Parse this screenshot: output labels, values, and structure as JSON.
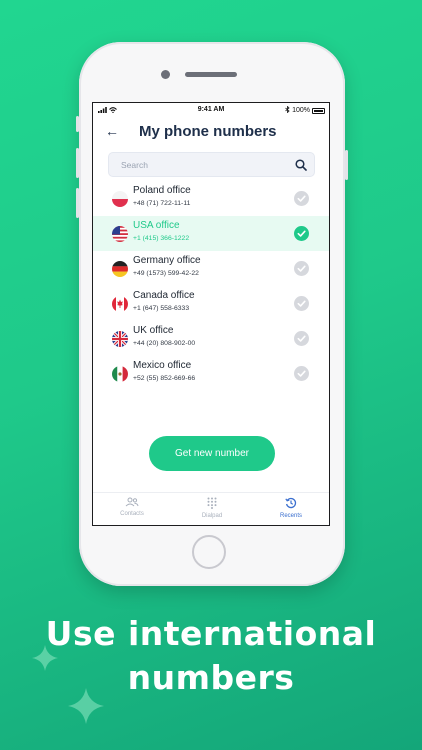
{
  "status_bar": {
    "time": "9:41 AM",
    "battery": "100%"
  },
  "header": {
    "back_icon": "arrow-left-icon",
    "title": "My phone numbers"
  },
  "search": {
    "placeholder": "Search"
  },
  "numbers": [
    {
      "name": "Poland office",
      "number": "+48 (71) 722-11-11",
      "flag": "poland-flag-icon",
      "selected": false
    },
    {
      "name": "USA office",
      "number": "+1 (415) 366-1222",
      "flag": "usa-flag-icon",
      "selected": true
    },
    {
      "name": "Germany office",
      "number": "+49 (1573) 599-42-22",
      "flag": "germany-flag-icon",
      "selected": false
    },
    {
      "name": "Canada office",
      "number": "+1 (647) 558-6333",
      "flag": "canada-flag-icon",
      "selected": false
    },
    {
      "name": "UK office",
      "number": "+44 (20) 808-902-00",
      "flag": "uk-flag-icon",
      "selected": false
    },
    {
      "name": "Mexico office",
      "number": "+52 (55) 852-669-66",
      "flag": "mexico-flag-icon",
      "selected": false
    }
  ],
  "cta_label": "Get new number",
  "tabs": [
    {
      "label": "Contacts",
      "icon": "contacts-icon",
      "active": false
    },
    {
      "label": "Dialpad",
      "icon": "dialpad-icon",
      "active": false
    },
    {
      "label": "Recents",
      "icon": "history-icon",
      "active": true
    }
  ],
  "promo": {
    "line1": "Use international",
    "line2": "numbers"
  },
  "colors": {
    "accent": "#1fc98a",
    "title": "#1e2f4a",
    "active_tab": "#3a6fcf",
    "background": "#1fc98a"
  }
}
